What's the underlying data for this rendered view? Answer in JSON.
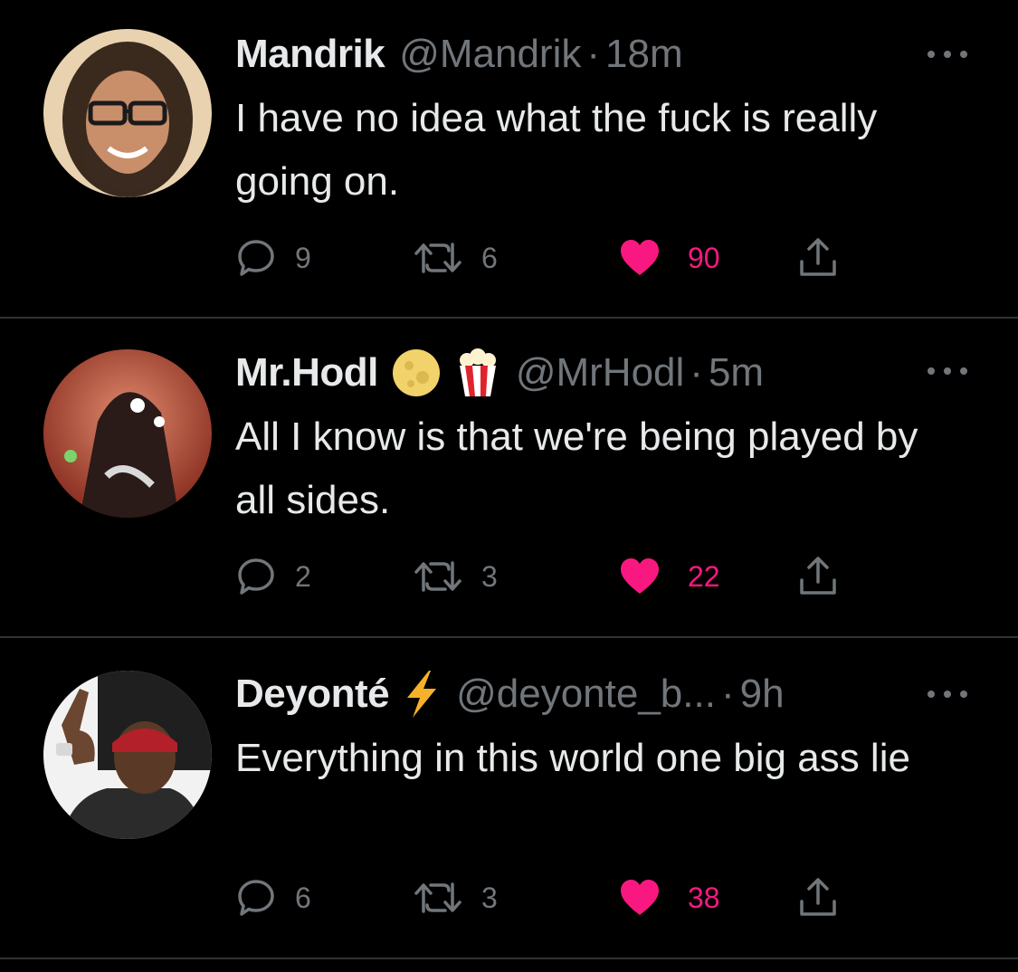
{
  "tweets": [
    {
      "name": "Mandrik",
      "handle": "@Mandrik",
      "separator": "·",
      "time": "18m",
      "text": "I have no idea what the fuck is really going on.",
      "badges": [],
      "replies": "9",
      "retweets": "6",
      "likes": "90",
      "liked": true
    },
    {
      "name": "Mr.Hodl",
      "handle": "@MrHodl",
      "separator": "·",
      "time": "5m",
      "text": "All I know is that we're being played by all sides.",
      "badges": [
        "moon-emoji",
        "popcorn-emoji"
      ],
      "replies": "2",
      "retweets": "3",
      "likes": "22",
      "liked": true
    },
    {
      "name": "Deyonté",
      "handle": "@deyonte_b...",
      "separator": "·",
      "time": "9h",
      "text": "Everything in this world one big ass lie",
      "badges": [
        "lightning-emoji"
      ],
      "replies": "6",
      "retweets": "3",
      "likes": "38",
      "liked": true
    }
  ],
  "colors": {
    "background": "#000000",
    "text": "#e7e9ea",
    "muted": "#71767b",
    "like": "#f91880",
    "divider": "#2f3336"
  }
}
